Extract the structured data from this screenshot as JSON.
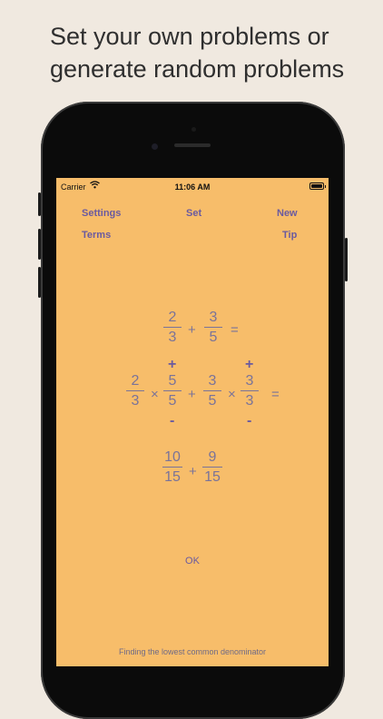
{
  "caption": {
    "line1": "Set your own problems or",
    "line2": "generate random problems"
  },
  "status_bar": {
    "carrier": "Carrier",
    "time": "11:06 AM"
  },
  "nav": {
    "settings": "Settings",
    "set": "Set",
    "new": "New",
    "terms": "Terms",
    "tip": "Tip"
  },
  "problem": {
    "a": {
      "num": "2",
      "den": "3"
    },
    "b": {
      "num": "3",
      "den": "5"
    },
    "plus": "+",
    "equals": "="
  },
  "expansion": {
    "a": {
      "num": "2",
      "den": "3"
    },
    "m1": {
      "num": "5",
      "den": "5"
    },
    "b": {
      "num": "3",
      "den": "5"
    },
    "m2": {
      "num": "3",
      "den": "3"
    },
    "times": "×",
    "plus": "+",
    "equals": "=",
    "inc": "+",
    "dec": "-"
  },
  "result": {
    "a": {
      "num": "10",
      "den": "15"
    },
    "b": {
      "num": "9",
      "den": "15"
    },
    "plus": "+"
  },
  "ok_label": "OK",
  "footer_text": "Finding the lowest common denominator",
  "colors": {
    "screen": "#f7bd6a",
    "accent": "#6a5aa0",
    "math": "#7a7399",
    "background": "#f0e9e0"
  }
}
